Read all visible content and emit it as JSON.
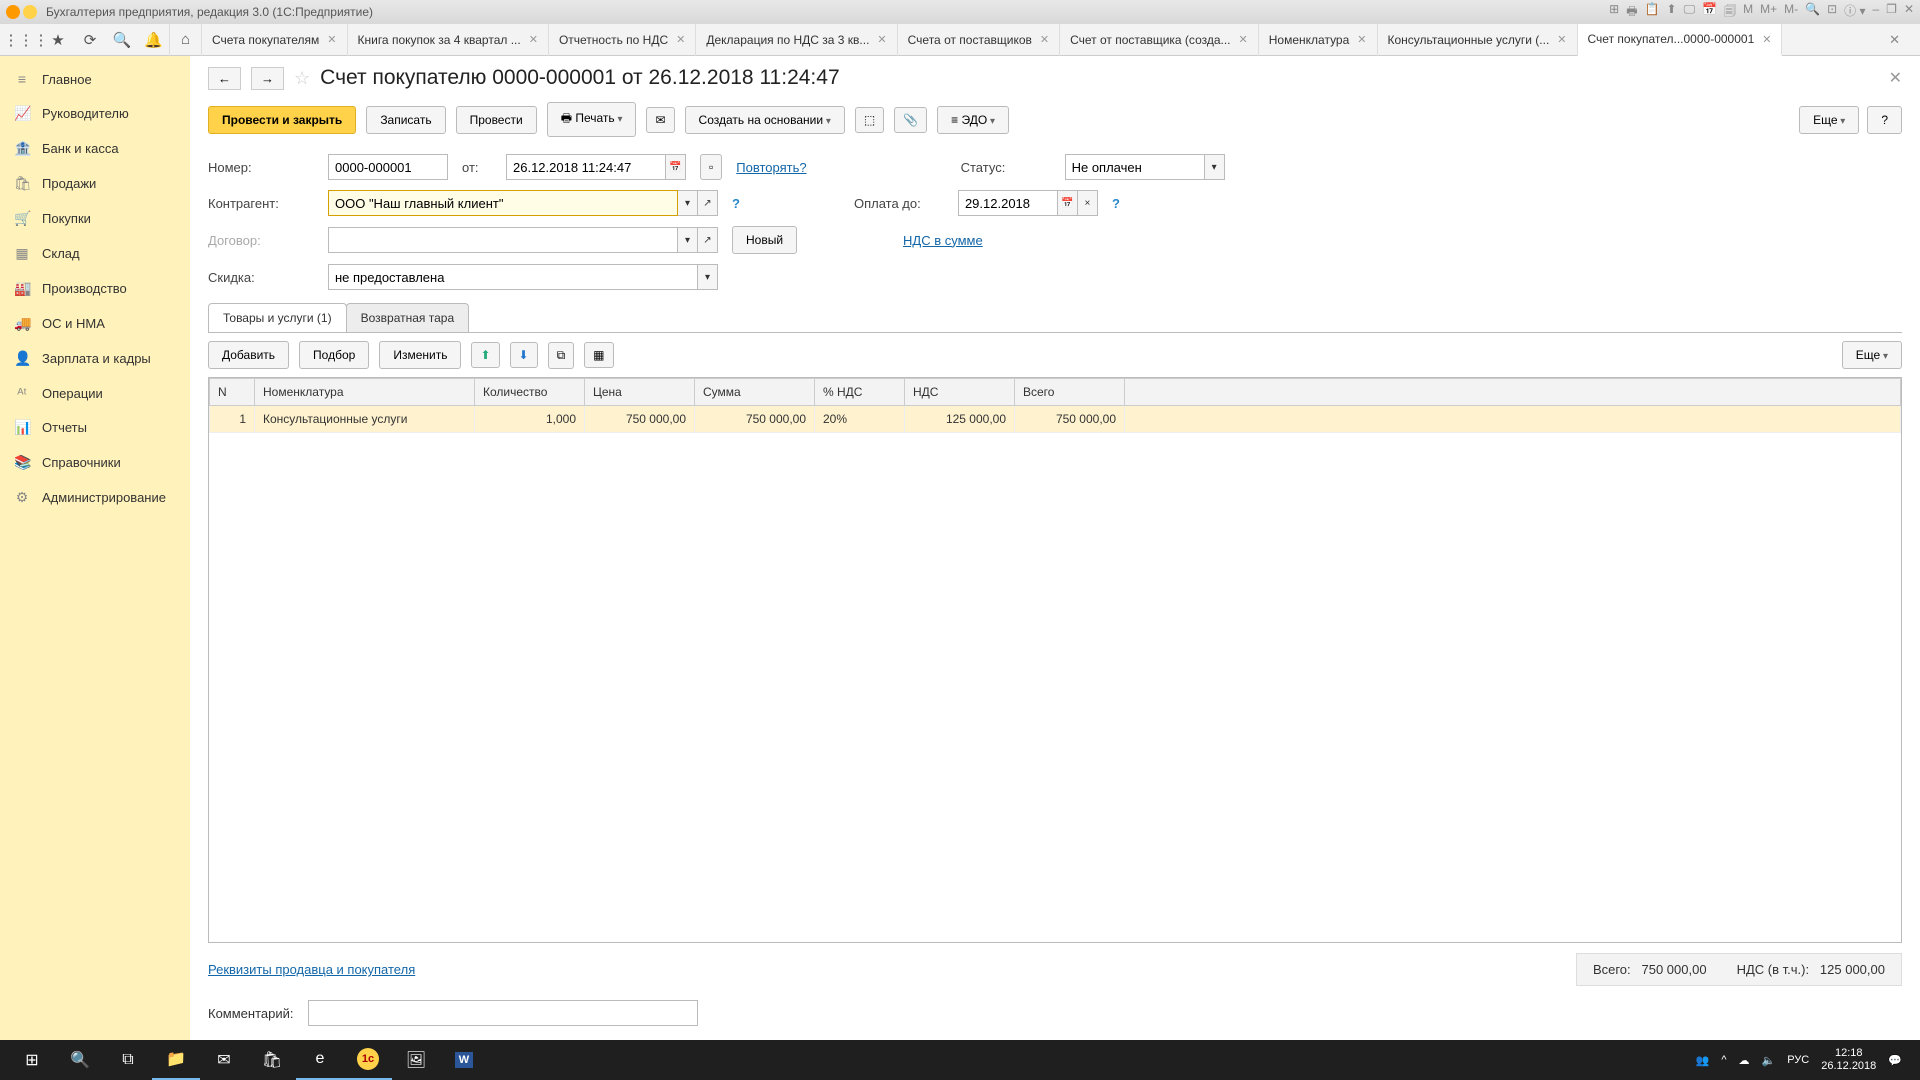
{
  "title_bar": {
    "text": "Бухгалтерия предприятия, редакция 3.0  (1С:Предприятие)"
  },
  "title_icons": [
    "⊞",
    "🖶",
    "📋",
    "⬆",
    "🖵",
    "📅",
    "🗐",
    "M",
    "M+",
    "M-",
    "🔍",
    "⊡",
    "ⓘ ▾",
    "–",
    "❐",
    "✕"
  ],
  "tool_icons": [
    "⋮⋮⋮",
    "★",
    "⟳",
    "🔍",
    "🔔",
    "⌂"
  ],
  "tabs": [
    {
      "label": "Счета покупателям"
    },
    {
      "label": "Книга покупок за 4 квартал ..."
    },
    {
      "label": "Отчетность по НДС"
    },
    {
      "label": "Декларация по НДС за 3 кв..."
    },
    {
      "label": "Счета от поставщиков"
    },
    {
      "label": "Счет от поставщика (созда..."
    },
    {
      "label": "Номенклатура"
    },
    {
      "label": "Консультационные услуги (..."
    },
    {
      "label": "Счет покупател...0000-000001",
      "active": true
    }
  ],
  "sidebar": [
    {
      "icon": "≡",
      "label": "Главное"
    },
    {
      "icon": "📈",
      "label": "Руководителю"
    },
    {
      "icon": "🏦",
      "label": "Банк и касса"
    },
    {
      "icon": "🛍",
      "label": "Продажи"
    },
    {
      "icon": "🛒",
      "label": "Покупки"
    },
    {
      "icon": "▦",
      "label": "Склад"
    },
    {
      "icon": "🏭",
      "label": "Производство"
    },
    {
      "icon": "🚚",
      "label": "ОС и НМА"
    },
    {
      "icon": "👤",
      "label": "Зарплата и кадры"
    },
    {
      "icon": "ᴬᵗ",
      "label": "Операции"
    },
    {
      "icon": "📊",
      "label": "Отчеты"
    },
    {
      "icon": "📚",
      "label": "Справочники"
    },
    {
      "icon": "⚙",
      "label": "Администрирование"
    }
  ],
  "doc": {
    "title": "Счет покупателю 0000-000001 от 26.12.2018 11:24:47",
    "toolbar": {
      "primary": "Провести и закрыть",
      "save": "Записать",
      "post": "Провести",
      "print": "Печать",
      "create_based": "Создать на основании",
      "edo": "ЭДО",
      "more": "Еще",
      "help": "?"
    },
    "fields": {
      "number_lbl": "Номер:",
      "number": "0000-000001",
      "from_lbl": "от:",
      "from": "26.12.2018 11:24:47",
      "repeat": "Повторять?",
      "status_lbl": "Статус:",
      "status": "Не оплачен",
      "counterparty_lbl": "Контрагент:",
      "counterparty": "ООО \"Наш главный клиент\"",
      "pay_lbl": "Оплата до:",
      "pay_until": "29.12.2018",
      "contract_lbl": "Договор:",
      "contract": "",
      "new": "Новый",
      "vat_link": "НДС в сумме",
      "discount_lbl": "Скидка:",
      "discount": "не предоставлена"
    },
    "subtabs": [
      {
        "label": "Товары и услуги (1)",
        "active": true
      },
      {
        "label": "Возвратная тара"
      }
    ],
    "tbltoolbar": {
      "add": "Добавить",
      "pick": "Подбор",
      "edit": "Изменить",
      "more": "Еще"
    },
    "columns": [
      "N",
      "Номенклатура",
      "Количество",
      "Цена",
      "Сумма",
      "% НДС",
      "НДС",
      "Всего"
    ],
    "rows": [
      {
        "n": "1",
        "name": "Консультационные услуги",
        "qty": "1,000",
        "price": "750 000,00",
        "sum": "750 000,00",
        "vatp": "20%",
        "vat": "125 000,00",
        "total": "750 000,00"
      }
    ],
    "footer": {
      "seller_link": "Реквизиты продавца и покупателя",
      "total_lbl": "Всего:",
      "total": "750 000,00",
      "vat_lbl": "НДС (в т.ч.):",
      "vat": "125 000,00",
      "comment_lbl": "Комментарий:"
    }
  },
  "taskbar": {
    "time": "12:18",
    "date": "26.12.2018",
    "lang": "РУС",
    "tray": [
      "👥",
      "^",
      "☁",
      "🔈"
    ]
  }
}
